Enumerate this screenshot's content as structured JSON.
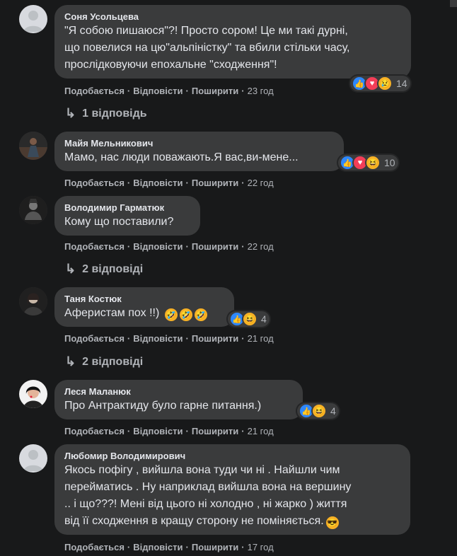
{
  "comments": [
    {
      "author": "Соня Усольцева",
      "text": "\"Я собою пишаюся\"?! Просто сором! Це ми такі дурні,\nщо повелися на цю\"альпіністку\" та вбили стільки часу,\nпрослідковуючи епохальне \"сходження\"!",
      "reactions": [
        "like-icon",
        "love-icon",
        "sad-icon"
      ],
      "reaction_count": "14",
      "like_label": "Подобається",
      "reply_label": "Відповісти",
      "share_label": "Поширити",
      "time": "23 год",
      "replies_label": "1 відповідь"
    },
    {
      "author": "Майя Мельникович",
      "text": "Мамо, нас люди поважають.Я вас,ви-мене...",
      "reactions": [
        "like-icon",
        "love-icon",
        "haha-icon"
      ],
      "reaction_count": "10",
      "like_label": "Подобається",
      "reply_label": "Відповісти",
      "share_label": "Поширити",
      "time": "22 год"
    },
    {
      "author": "Володимир Гарматюк",
      "text": "Кому що поставили?",
      "like_label": "Подобається",
      "reply_label": "Відповісти",
      "share_label": "Поширити",
      "time": "22 год",
      "replies_label": "2 відповіді"
    },
    {
      "author": "Таня Костюк",
      "text": "Аферистам пох !!)",
      "reactions": [
        "like-icon",
        "haha-icon"
      ],
      "reaction_count": "4",
      "like_label": "Подобається",
      "reply_label": "Відповісти",
      "share_label": "Поширити",
      "time": "21 год",
      "replies_label": "2 відповіді"
    },
    {
      "author": "Леся Маланюк",
      "text": "Про Антрактиду було гарне питання.)",
      "reactions": [
        "like-icon",
        "haha-icon"
      ],
      "reaction_count": "4",
      "like_label": "Подобається",
      "reply_label": "Відповісти",
      "share_label": "Поширити",
      "time": "21 год"
    },
    {
      "author": "Любомир Володимирович",
      "text": "Якось пофігу , вийшла вона туди чи ні . Найшли чим\nперейматись . Ну наприклад вийшла вона на вершину\n.. і що???! Мені від цього ні холодно , ні жарко ) життя\nвід її сходження в кращу сторону не поміняється.",
      "like_label": "Подобається",
      "reply_label": "Відповісти",
      "share_label": "Поширити",
      "time": "17 год"
    }
  ],
  "colors": {
    "background": "#18191a",
    "bubble": "#3a3b3c",
    "text": "#e4e6eb",
    "muted": "#b0b3b8",
    "like": "#2d88ff",
    "love": "#f33e58",
    "haha": "#f7b125"
  }
}
